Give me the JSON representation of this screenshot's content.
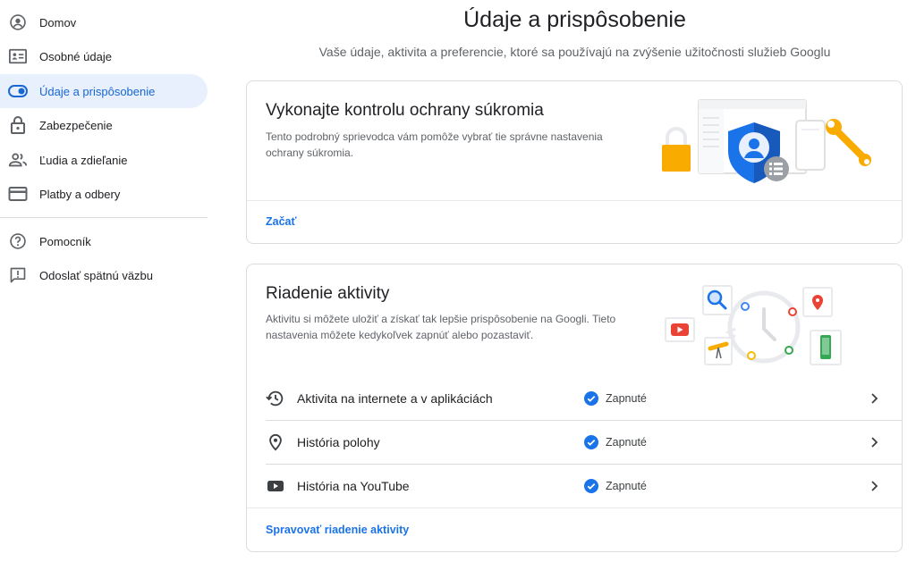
{
  "sidebar": {
    "items": [
      {
        "label": "Domov",
        "icon": "account-circle-icon"
      },
      {
        "label": "Osobné údaje",
        "icon": "id-card-icon"
      },
      {
        "label": "Údaje a prispôsobenie",
        "icon": "toggle-icon",
        "active": true
      },
      {
        "label": "Zabezpečenie",
        "icon": "lock-icon"
      },
      {
        "label": "Ľudia a zdieľanie",
        "icon": "people-icon"
      },
      {
        "label": "Platby a odbery",
        "icon": "credit-card-icon"
      },
      {
        "label": "Pomocník",
        "icon": "help-icon"
      },
      {
        "label": "Odoslať spätnú väzbu",
        "icon": "feedback-icon"
      }
    ]
  },
  "header": {
    "title": "Údaje a prispôsobenie",
    "subtitle": "Vaše údaje, aktivita a preferencie, ktoré sa používajú na zvýšenie užitočnosti služieb Googlu"
  },
  "privacy_card": {
    "title": "Vykonajte kontrolu ochrany súkromia",
    "description": "Tento podrobný sprievodca vám pomôže vybrať tie správne nastavenia ochrany súkromia.",
    "link": "Začať"
  },
  "activity_card": {
    "title": "Riadenie aktivity",
    "description": "Aktivitu si môžete uložiť a získať tak lepšie prispôsobenie na Googli. Tieto nastavenia môžete kedykoľvek zapnúť alebo pozastaviť.",
    "rows": [
      {
        "label": "Aktivita na internete a v aplikáciách",
        "status": "Zapnuté",
        "icon": "history-icon"
      },
      {
        "label": "História polohy",
        "status": "Zapnuté",
        "icon": "location-pin-icon"
      },
      {
        "label": "História na YouTube",
        "status": "Zapnuté",
        "icon": "youtube-icon"
      }
    ],
    "link": "Spravovať riadenie aktivity"
  },
  "colors": {
    "accent": "#1a73e8",
    "active_bg": "#e8f0fe",
    "active_text": "#1967d2",
    "border": "#dadce0"
  }
}
